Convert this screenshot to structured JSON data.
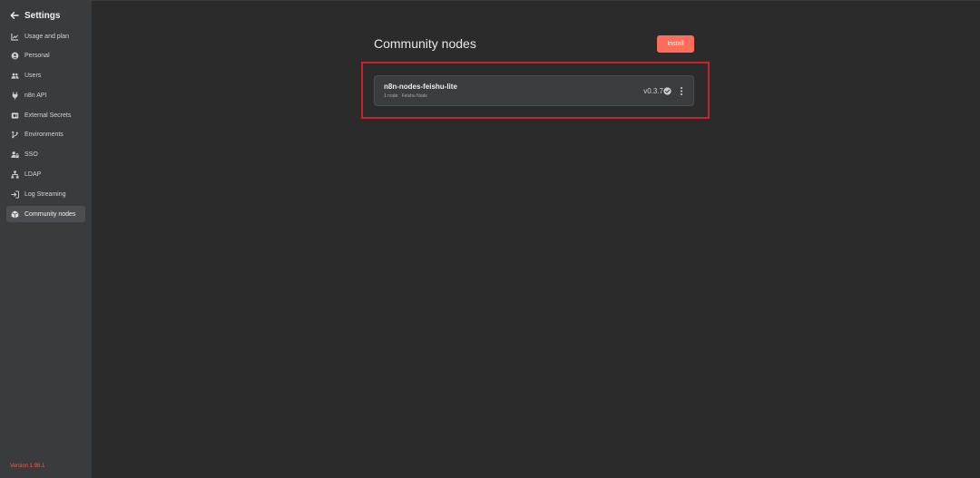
{
  "sidebar": {
    "title": "Settings",
    "items": [
      {
        "label": "Usage and plan",
        "icon": "chart-icon"
      },
      {
        "label": "Personal",
        "icon": "user-circle-icon"
      },
      {
        "label": "Users",
        "icon": "users-icon"
      },
      {
        "label": "n8n API",
        "icon": "plug-icon"
      },
      {
        "label": "External Secrets",
        "icon": "vault-icon"
      },
      {
        "label": "Environments",
        "icon": "git-branch-icon"
      },
      {
        "label": "SSO",
        "icon": "user-lock-icon"
      },
      {
        "label": "LDAP",
        "icon": "network-icon"
      },
      {
        "label": "Log Streaming",
        "icon": "sign-in-icon"
      },
      {
        "label": "Community nodes",
        "icon": "cube-icon"
      }
    ],
    "active_item": "Community nodes",
    "version": "Version 1.98.1"
  },
  "main": {
    "title": "Community nodes",
    "install_label": "Install",
    "nodes": [
      {
        "name": "n8n-nodes-feishu-lite",
        "count": "1 node:",
        "node_names": "Feishu Node",
        "version": "v0.3.7"
      }
    ]
  },
  "colors": {
    "accent": "#ff6d5a",
    "highlight_border": "#c8232c",
    "version_text": "#e8604c"
  }
}
